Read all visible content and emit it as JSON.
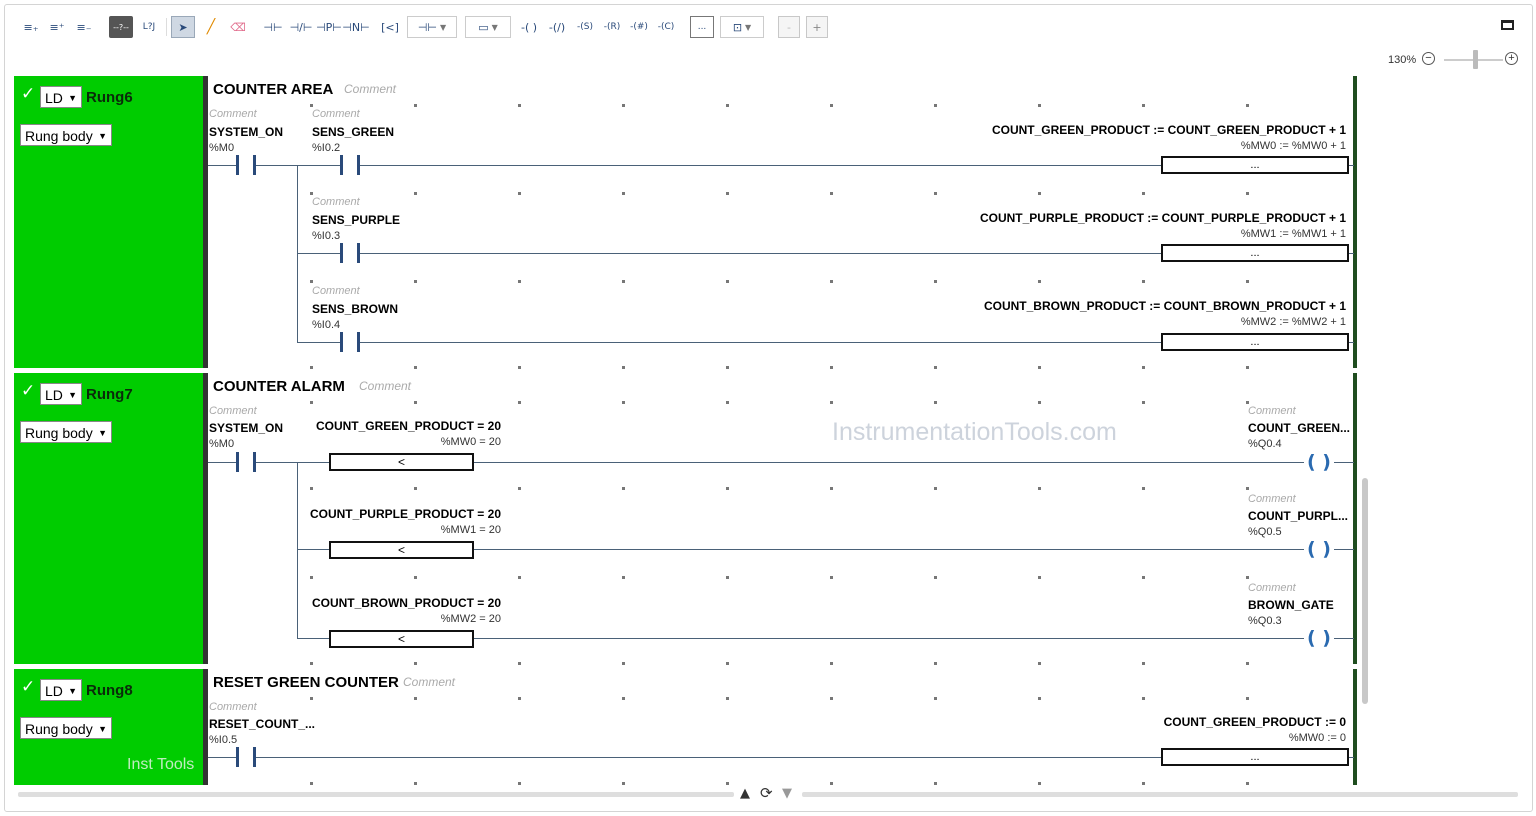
{
  "toolbar": {
    "btn_insert_rung_above": "≡₊",
    "btn_insert_rung_below": "≡⁺",
    "btn_delete_rung": "≡₋",
    "btn_comment_toggle": "--?--",
    "btn_label": "L?J",
    "btn_select": "➤",
    "btn_draw_line": "╱",
    "btn_erase": "⌫",
    "btn_no_contact": "⊣⊢",
    "btn_nc_contact": "⊣/⊢",
    "btn_p_contact": "⊣P⊢",
    "btn_n_contact": "⊣N⊢",
    "btn_compare": "[<]",
    "btn_contact_dropdown": "⊣⊢",
    "btn_block_dropdown": "▭",
    "btn_coil": "-( )",
    "btn_nc_coil": "-(/)",
    "btn_set_coil": "-(S)",
    "btn_reset_coil": "-(R)",
    "btn_hash_coil": "-(#)",
    "btn_call_coil": "-(C)",
    "btn_operation_block": "...",
    "btn_function_block": "⊡",
    "btn_zoom_out_small": "-",
    "btn_zoom_in_small": "+"
  },
  "zoom": {
    "label": "130%",
    "minus": "−",
    "plus": "+",
    "level_fraction": 0.5
  },
  "colors": {
    "rung_side": "#00cc00",
    "wire": "#4a6178",
    "coil": "#2a6ab0"
  },
  "rungs": [
    {
      "check": "✓",
      "lang": "LD",
      "name": "Rung6",
      "body_label": "Rung body",
      "title": "COUNTER AREA",
      "comment": "Comment",
      "branches": [
        {
          "contact_comment": "Comment",
          "contact_var": "SYSTEM_ON",
          "contact_addr": "%M0",
          "contact2_comment": "Comment",
          "contact2_var": "SENS_GREEN",
          "contact2_addr": "%I0.2",
          "expr": "COUNT_GREEN_PRODUCT := COUNT_GREEN_PRODUCT + 1",
          "expr_addr": "%MW0 := %MW0 + 1",
          "box": "..."
        },
        {
          "contact2_comment": "Comment",
          "contact2_var": "SENS_PURPLE",
          "contact2_addr": "%I0.3",
          "expr": "COUNT_PURPLE_PRODUCT := COUNT_PURPLE_PRODUCT + 1",
          "expr_addr": "%MW1 := %MW1 + 1",
          "box": "..."
        },
        {
          "contact2_comment": "Comment",
          "contact2_var": "SENS_BROWN",
          "contact2_addr": "%I0.4",
          "expr": "COUNT_BROWN_PRODUCT := COUNT_BROWN_PRODUCT + 1",
          "expr_addr": "%MW2 := %MW2 + 1",
          "box": "..."
        }
      ]
    },
    {
      "check": "✓",
      "lang": "LD",
      "name": "Rung7",
      "body_label": "Rung body",
      "title": "COUNTER ALARM",
      "comment": "Comment",
      "branches": [
        {
          "contact_comment": "Comment",
          "contact_var": "SYSTEM_ON",
          "contact_addr": "%M0",
          "cmp_expr": "COUNT_GREEN_PRODUCT = 20",
          "cmp_addr": "%MW0 = 20",
          "cmp_box": "<",
          "coil_comment": "Comment",
          "coil_var": "COUNT_GREEN...",
          "coil_addr": "%Q0.4"
        },
        {
          "cmp_expr": "COUNT_PURPLE_PRODUCT = 20",
          "cmp_addr": "%MW1 = 20",
          "cmp_box": "<",
          "coil_comment": "Comment",
          "coil_var": "COUNT_PURPL...",
          "coil_addr": "%Q0.5"
        },
        {
          "cmp_expr": "COUNT_BROWN_PRODUCT = 20",
          "cmp_addr": "%MW2 = 20",
          "cmp_box": "<",
          "coil_comment": "Comment",
          "coil_var": "BROWN_GATE",
          "coil_addr": "%Q0.3"
        }
      ]
    },
    {
      "check": "✓",
      "lang": "LD",
      "name": "Rung8",
      "body_label": "Rung body",
      "title": "RESET GREEN COUNTER",
      "comment": "Comment",
      "watermark": "Inst Tools",
      "branches": [
        {
          "contact_comment": "Comment",
          "contact_var": "RESET_COUNT_...",
          "contact_addr": "%I0.5",
          "expr": "COUNT_GREEN_PRODUCT := 0",
          "expr_addr": "%MW0 := 0",
          "box": "..."
        }
      ]
    }
  ],
  "coil_glyph": "( )",
  "watermark": "InstrumentationTools.com",
  "nav": {
    "up": "▲",
    "refresh": "⟳",
    "down": "▼"
  }
}
